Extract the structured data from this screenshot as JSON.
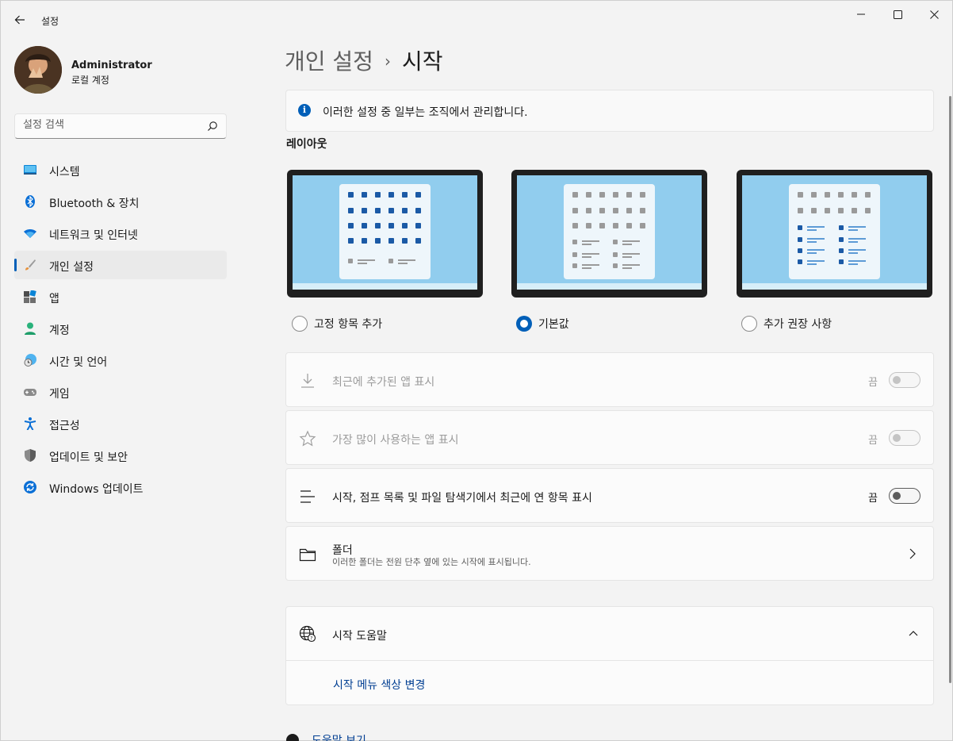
{
  "window": {
    "title": "설정",
    "back_icon": "arrow-left-icon",
    "minimize_icon": "minimize-icon",
    "maximize_icon": "maximize-icon",
    "close_icon": "close-icon"
  },
  "profile": {
    "name": "Administrator",
    "account_type": "로컬 계정"
  },
  "search": {
    "placeholder": "설정 검색",
    "icon": "search-icon"
  },
  "sidebar": {
    "items": [
      {
        "label": "시스템",
        "icon": "system-monitor-icon"
      },
      {
        "label": "Bluetooth & 장치",
        "icon": "bluetooth-icon"
      },
      {
        "label": "네트워크 및 인터넷",
        "icon": "wifi-icon"
      },
      {
        "label": "개인 설정",
        "icon": "paintbrush-icon",
        "selected": true
      },
      {
        "label": "앱",
        "icon": "apps-icon"
      },
      {
        "label": "계정",
        "icon": "person-icon"
      },
      {
        "label": "시간 및 언어",
        "icon": "globe-clock-icon"
      },
      {
        "label": "게임",
        "icon": "gamepad-icon"
      },
      {
        "label": "접근성",
        "icon": "accessibility-icon"
      },
      {
        "label": "업데이트 및 보안",
        "icon": "shield-icon"
      },
      {
        "label": "Windows 업데이트",
        "icon": "windows-update-icon"
      }
    ]
  },
  "breadcrumb": {
    "parent": "개인 설정",
    "separator": "›",
    "current": "시작"
  },
  "info_bar": {
    "text": "이러한 설정 중 일부는 조직에서 관리합니다.",
    "icon": "info-icon"
  },
  "layout": {
    "title": "레이아웃",
    "options": [
      {
        "label": "고정 항목 추가",
        "selected": false
      },
      {
        "label": "기본값",
        "selected": true
      },
      {
        "label": "추가 권장 사항",
        "selected": false
      }
    ]
  },
  "settings": [
    {
      "label": "최근에 추가된 앱 표시",
      "state": "끔",
      "disabled": true,
      "icon": "download-icon"
    },
    {
      "label": "가장 많이 사용하는 앱 표시",
      "state": "끔",
      "disabled": true,
      "icon": "star-icon"
    },
    {
      "label": "시작, 점프 목록 및 파일 탐색기에서 최근에 연 항목 표시",
      "state": "끔",
      "disabled": false,
      "icon": "list-icon"
    }
  ],
  "folders": {
    "label": "폴더",
    "description": "이러한 폴더는 전원 단추 옆에 있는 시작에 표시됩니다.",
    "icon": "folder-icon"
  },
  "help": {
    "title": "시작 도움말",
    "link": "시작 메뉴 색상 변경",
    "icon": "globe-help-icon"
  },
  "footer": {
    "link": "도움말 보기"
  },
  "colors": {
    "accent": "#005fb8",
    "link": "#003e92"
  }
}
